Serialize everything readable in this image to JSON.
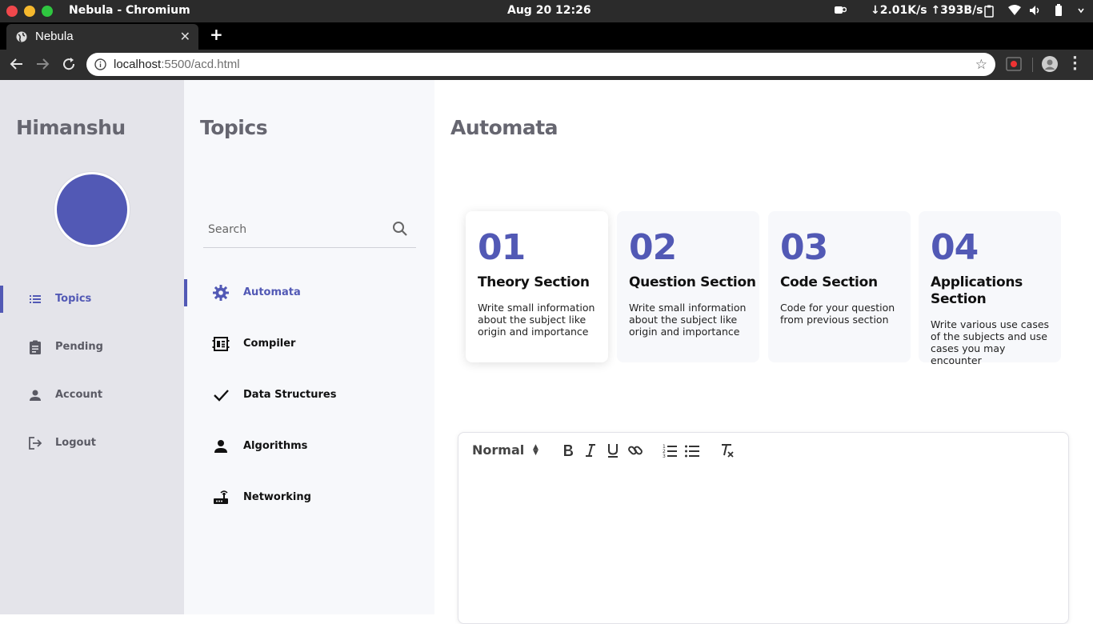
{
  "os": {
    "window_title": "Nebula - Chromium",
    "clock": "Aug 20  12:26",
    "network": "↓2.01K/s ↑393B/s"
  },
  "browser": {
    "tab_title": "Nebula",
    "url_host": "localhost",
    "url_rest": ":5500/acd.html"
  },
  "sidebar": {
    "user_name": "Himanshu",
    "items": [
      {
        "label": "Topics",
        "icon": "list-icon"
      },
      {
        "label": "Pending",
        "icon": "clipboard-icon"
      },
      {
        "label": "Account",
        "icon": "person-icon"
      },
      {
        "label": "Logout",
        "icon": "logout-icon"
      }
    ]
  },
  "topics": {
    "title": "Topics",
    "search_placeholder": "Search",
    "items": [
      {
        "label": "Automata",
        "icon": "gear-icon"
      },
      {
        "label": "Compiler",
        "icon": "chip-icon"
      },
      {
        "label": "Data Structures",
        "icon": "check-icon"
      },
      {
        "label": "Algorithms",
        "icon": "person-icon"
      },
      {
        "label": "Networking",
        "icon": "router-icon"
      }
    ]
  },
  "main": {
    "title": "Automata",
    "cards": [
      {
        "num": "01",
        "title": "Theory Section",
        "desc": "Write small information about the subject like origin and importance"
      },
      {
        "num": "02",
        "title": "Question Section",
        "desc": "Write small information about the subject like origin and importance"
      },
      {
        "num": "03",
        "title": "Code Section",
        "desc": "Code for your question from previous section"
      },
      {
        "num": "04",
        "title": "Applications Section",
        "desc": "Write various use cases of the subjects and use cases you may encounter"
      }
    ],
    "editor": {
      "format": "Normal"
    }
  },
  "colors": {
    "accent": "#5259b5",
    "sidebar_bg": "#e4e4ea",
    "panel_bg": "#f7f8fb"
  }
}
